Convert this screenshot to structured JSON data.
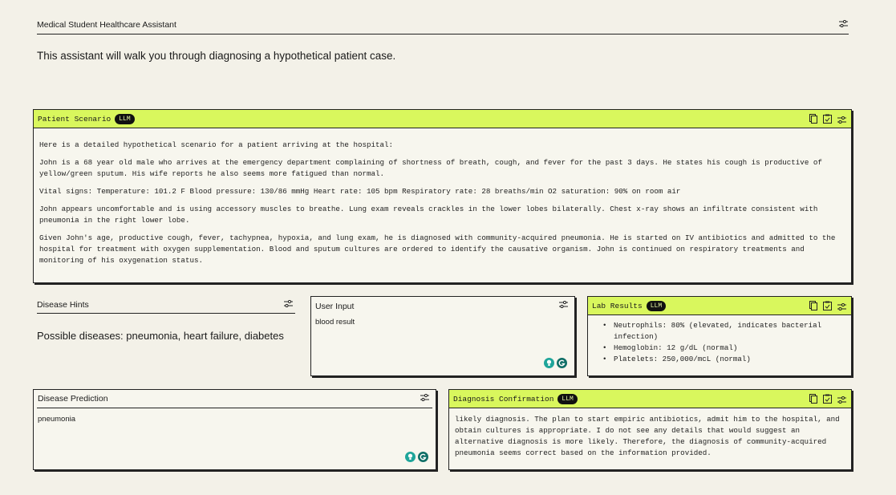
{
  "header": {
    "title": "Medical Student Healthcare Assistant",
    "settings_icon": "sliders-icon"
  },
  "intro": "This assistant will walk you through diagnosing a hypothetical patient case.",
  "scenario": {
    "title": "Patient Scenario",
    "badge": "LLM",
    "paragraphs": [
      "Here is a detailed hypothetical scenario for a patient arriving at the hospital:",
      "John is a 68 year old male who arrives at the emergency department complaining of shortness of breath, cough, and fever for the past 3 days. He states his cough is productive of yellow/green sputum. His wife reports he also seems more fatigued than normal.",
      "Vital signs: Temperature: 101.2 F Blood pressure: 130/86 mmHg Heart rate: 105 bpm Respiratory rate: 28 breaths/min O2 saturation: 90% on room air",
      "John appears uncomfortable and is using accessory muscles to breathe. Lung exam reveals crackles in the lower lobes bilaterally. Chest x-ray shows an infiltrate consistent with pneumonia in the right lower lobe.",
      "Given John's age, productive cough, fever, tachypnea, hypoxia, and lung exam, he is diagnosed with community-acquired pneumonia. He is started on IV antibiotics and admitted to the hospital for treatment with oxygen supplementation. Blood and sputum cultures are ordered to identify the causative organism. John is continued on respiratory treatments and monitoring of his oxygenation status."
    ]
  },
  "hints": {
    "title": "Disease Hints",
    "text": "Possible diseases: pneumonia, heart failure, diabetes"
  },
  "user_input": {
    "title": "User Input",
    "value": "blood result"
  },
  "labs": {
    "title": "Lab Results",
    "badge": "LLM",
    "items": [
      "Neutrophils: 80% (elevated, indicates bacterial infection)",
      "Hemoglobin: 12 g/dL (normal)",
      "Platelets: 250,000/mcL (normal)"
    ]
  },
  "prediction": {
    "title": "Disease Prediction",
    "value": "pneumonia"
  },
  "confirmation": {
    "title": "Diagnosis Confirmation",
    "badge": "LLM",
    "text": "likely diagnosis. The plan to start empiric antibiotics, admit him to the hospital, and obtain cultures is appropriate. I do not see any details that would suggest an alternative diagnosis is more likely. Therefore, the diagnosis of community-acquired pneumonia seems correct based on the information provided."
  },
  "colors": {
    "accent": "#d9f75d",
    "background": "#f3f1e8",
    "badge": "#111111",
    "teal": "#1fa59a"
  }
}
